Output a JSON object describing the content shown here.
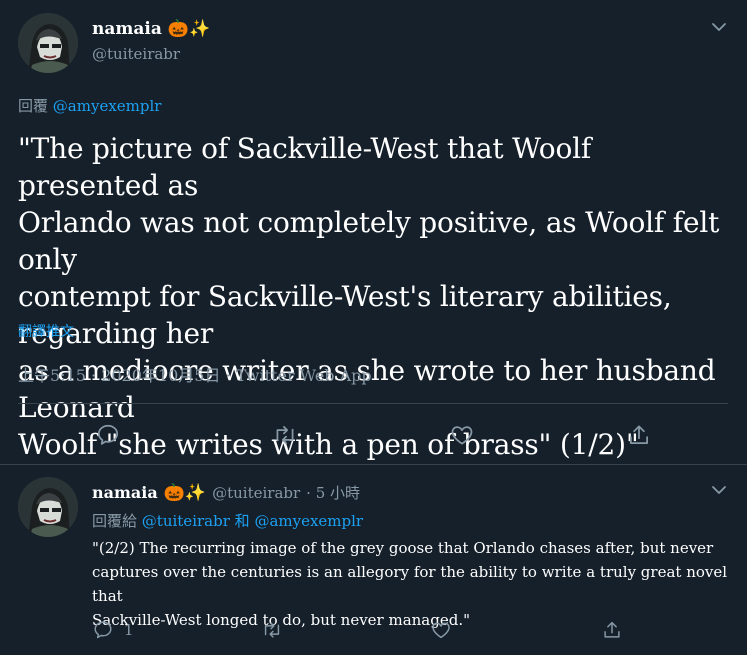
{
  "main_tweet": {
    "display_name": "namaia",
    "emoji": "🎃✨",
    "handle": "@tuiteirabr",
    "reply_prefix": "回覆",
    "reply_to": "@amyexemplr",
    "text_lines": [
      "\"The picture of Sackville-West that Woolf presented as",
      "Orlando was not completely positive, as Woolf felt only",
      "contempt for Sackville-West's literary abilities, regarding her",
      "as a mediocre writer as she wrote to her husband Leonard",
      "Woolf \"she writes with a pen of brass\" (1/2)\""
    ],
    "translate_label": "翻譯推文",
    "timestamp": "上午5:15 · 2020年10月5日 · Twitter Web App"
  },
  "reply_tweet": {
    "display_name": "namaia",
    "emoji": "🎃✨",
    "handle": "@tuiteirabr",
    "time_ago": "· 5 小時",
    "reply_prefix": "回覆給",
    "reply_to_1": "@tuiteirabr",
    "reply_join": "和",
    "reply_to_2": "@amyexemplr",
    "text_lines": [
      "\"(2/2) The recurring image of the grey goose that Orlando chases after, but never",
      "captures over the centuries is an allegory for the ability to write a truly great novel that",
      "Sackville-West longed to do, but never managed.\""
    ],
    "reply_count": "1"
  },
  "colors": {
    "background": "#15202b",
    "text": "#ffffff",
    "muted": "#8899a6",
    "link": "#1da1f2",
    "divider": "#38444d"
  }
}
